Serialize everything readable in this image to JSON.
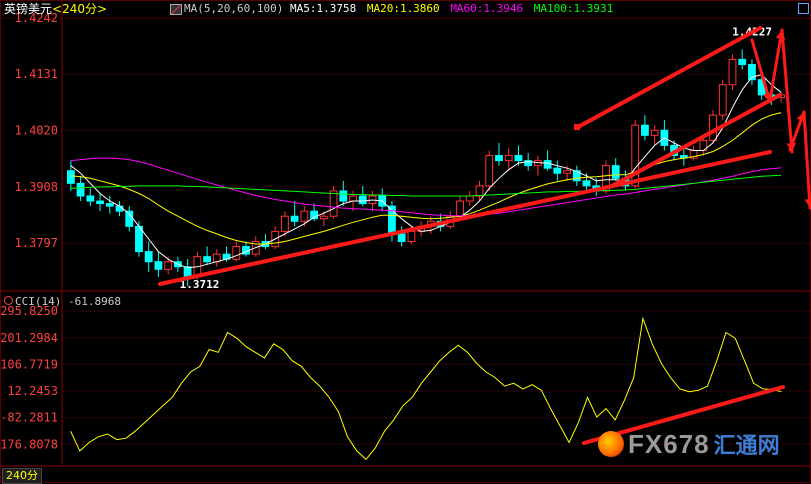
{
  "header": {
    "symbol": "英镑美元",
    "period": "<240分>",
    "ma_prefix": "MA(5,20,60,100)",
    "ma5": "MA5:1.3758",
    "ma20": "MA20:1.3860",
    "ma60": "MA60:1.3946",
    "ma100": "MA100:1.3931"
  },
  "cci_header": "CCI(14)  -61.8968",
  "bottom_period": "240分",
  "watermark": {
    "brand": "FX678",
    "cn": "汇通网"
  },
  "low_label": "1.3712",
  "high_label": "1.4227",
  "colors": {
    "up": "#ff3333",
    "down": "#00ffff",
    "ma5": "#ffffff",
    "ma20": "#ffff00",
    "ma60": "#ff00ff",
    "ma100": "#00ff00",
    "cci": "#ffff00",
    "annotation": "#ff1a1a",
    "grid": "#8b0000",
    "axis_text": "#ff4040"
  },
  "chart_data": [
    {
      "type": "candlestick",
      "title": "英镑美元 240分",
      "ylim": [
        1.3712,
        1.4242
      ],
      "yticks": [
        "1.4242",
        "1.4131",
        "1.4020",
        "1.3908",
        "1.3797"
      ],
      "ytick_values": [
        1.4242,
        1.4131,
        1.402,
        1.3908,
        1.3797
      ],
      "annotations": {
        "low": 1.3712,
        "high": 1.4227
      },
      "series_ohlc": [
        [
          1.394,
          1.396,
          1.39,
          1.3915
        ],
        [
          1.3915,
          1.393,
          1.388,
          1.389
        ],
        [
          1.389,
          1.3905,
          1.387,
          1.388
        ],
        [
          1.388,
          1.3895,
          1.386,
          1.3875
        ],
        [
          1.3875,
          1.389,
          1.3855,
          1.387
        ],
        [
          1.387,
          1.388,
          1.385,
          1.386
        ],
        [
          1.386,
          1.387,
          1.382,
          1.383
        ],
        [
          1.383,
          1.384,
          1.377,
          1.378
        ],
        [
          1.378,
          1.38,
          1.374,
          1.376
        ],
        [
          1.376,
          1.378,
          1.373,
          1.3745
        ],
        [
          1.3745,
          1.377,
          1.3735,
          1.376
        ],
        [
          1.376,
          1.377,
          1.374,
          1.375
        ],
        [
          1.375,
          1.3765,
          1.3712,
          1.373
        ],
        [
          1.373,
          1.378,
          1.3725,
          1.377
        ],
        [
          1.377,
          1.379,
          1.3755,
          1.376
        ],
        [
          1.376,
          1.3785,
          1.375,
          1.3775
        ],
        [
          1.3775,
          1.379,
          1.376,
          1.3765
        ],
        [
          1.3765,
          1.38,
          1.376,
          1.379
        ],
        [
          1.379,
          1.38,
          1.377,
          1.3775
        ],
        [
          1.3775,
          1.381,
          1.377,
          1.38
        ],
        [
          1.38,
          1.3815,
          1.3785,
          1.379
        ],
        [
          1.379,
          1.383,
          1.3785,
          1.382
        ],
        [
          1.382,
          1.386,
          1.381,
          1.385
        ],
        [
          1.385,
          1.388,
          1.383,
          1.384
        ],
        [
          1.384,
          1.387,
          1.383,
          1.386
        ],
        [
          1.386,
          1.3875,
          1.384,
          1.3845
        ],
        [
          1.3845,
          1.386,
          1.383,
          1.385
        ],
        [
          1.385,
          1.391,
          1.3845,
          1.39
        ],
        [
          1.39,
          1.392,
          1.387,
          1.388
        ],
        [
          1.388,
          1.39,
          1.386,
          1.389
        ],
        [
          1.389,
          1.391,
          1.387,
          1.3875
        ],
        [
          1.3875,
          1.39,
          1.386,
          1.389
        ],
        [
          1.389,
          1.3905,
          1.386,
          1.387
        ],
        [
          1.387,
          1.388,
          1.38,
          1.3815
        ],
        [
          1.3815,
          1.383,
          1.379,
          1.38
        ],
        [
          1.38,
          1.383,
          1.3795,
          1.382
        ],
        [
          1.382,
          1.384,
          1.381,
          1.383
        ],
        [
          1.383,
          1.385,
          1.3815,
          1.384
        ],
        [
          1.384,
          1.3855,
          1.382,
          1.383
        ],
        [
          1.383,
          1.386,
          1.3825,
          1.385
        ],
        [
          1.385,
          1.389,
          1.3845,
          1.388
        ],
        [
          1.388,
          1.39,
          1.387,
          1.389
        ],
        [
          1.389,
          1.392,
          1.388,
          1.391
        ],
        [
          1.391,
          1.398,
          1.39,
          1.397
        ],
        [
          1.397,
          1.3995,
          1.395,
          1.396
        ],
        [
          1.396,
          1.3985,
          1.394,
          1.397
        ],
        [
          1.397,
          1.399,
          1.395,
          1.396
        ],
        [
          1.396,
          1.3975,
          1.394,
          1.395
        ],
        [
          1.395,
          1.397,
          1.393,
          1.396
        ],
        [
          1.396,
          1.398,
          1.394,
          1.3945
        ],
        [
          1.3945,
          1.396,
          1.392,
          1.3935
        ],
        [
          1.3935,
          1.395,
          1.392,
          1.394
        ],
        [
          1.394,
          1.395,
          1.391,
          1.392
        ],
        [
          1.392,
          1.3935,
          1.39,
          1.391
        ],
        [
          1.391,
          1.3925,
          1.389,
          1.39
        ],
        [
          1.39,
          1.396,
          1.3895,
          1.395
        ],
        [
          1.395,
          1.3965,
          1.392,
          1.3925
        ],
        [
          1.3925,
          1.394,
          1.39,
          1.391
        ],
        [
          1.391,
          1.404,
          1.3905,
          1.403
        ],
        [
          1.403,
          1.405,
          1.4,
          1.401
        ],
        [
          1.401,
          1.403,
          1.399,
          1.402
        ],
        [
          1.402,
          1.404,
          1.398,
          1.399
        ],
        [
          1.399,
          1.4,
          1.396,
          1.397
        ],
        [
          1.397,
          1.3985,
          1.395,
          1.3965
        ],
        [
          1.3965,
          1.399,
          1.396,
          1.398
        ],
        [
          1.398,
          1.401,
          1.397,
          1.4
        ],
        [
          1.4,
          1.406,
          1.3995,
          1.405
        ],
        [
          1.405,
          1.412,
          1.404,
          1.411
        ],
        [
          1.411,
          1.417,
          1.41,
          1.416
        ],
        [
          1.416,
          1.418,
          1.414,
          1.415
        ],
        [
          1.415,
          1.416,
          1.411,
          1.412
        ],
        [
          1.412,
          1.413,
          1.408,
          1.409
        ],
        [
          1.409,
          1.41,
          1.407,
          1.4085
        ],
        [
          1.4085,
          1.4095,
          1.4075,
          1.409
        ]
      ],
      "ma_series": [
        {
          "name": "MA5",
          "values": [
            1.395,
            1.3935,
            1.3915,
            1.3895,
            1.388,
            1.387,
            1.3855,
            1.383,
            1.3805,
            1.378,
            1.3765,
            1.3755,
            1.3748,
            1.375,
            1.3755,
            1.376,
            1.3765,
            1.3772,
            1.378,
            1.3788,
            1.3795,
            1.3805,
            1.3815,
            1.3825,
            1.3835,
            1.3848,
            1.3856,
            1.3865,
            1.3875,
            1.388,
            1.388,
            1.3882,
            1.388,
            1.3862,
            1.3845,
            1.383,
            1.382,
            1.3822,
            1.383,
            1.3838,
            1.3848,
            1.3862,
            1.388,
            1.3905,
            1.3925,
            1.3942,
            1.3955,
            1.3958,
            1.3956,
            1.3955,
            1.395,
            1.3945,
            1.3938,
            1.393,
            1.392,
            1.3922,
            1.3922,
            1.392,
            1.3945,
            1.3968,
            1.399,
            1.4005,
            1.3995,
            1.3985,
            1.398,
            1.398,
            1.3995,
            1.4025,
            1.4065,
            1.41,
            1.4125,
            1.413,
            1.411,
            1.4095
          ]
        },
        {
          "name": "MA20",
          "values": [
            1.393,
            1.3928,
            1.3925,
            1.392,
            1.3915,
            1.391,
            1.3903,
            1.3895,
            1.3885,
            1.3872,
            1.386,
            1.385,
            1.384,
            1.383,
            1.3822,
            1.3815,
            1.3808,
            1.3802,
            1.3798,
            1.3795,
            1.3795,
            1.3797,
            1.38,
            1.3805,
            1.381,
            1.3815,
            1.382,
            1.3826,
            1.3832,
            1.3838,
            1.3843,
            1.3848,
            1.3852,
            1.3852,
            1.385,
            1.3848,
            1.3846,
            1.3845,
            1.3846,
            1.3848,
            1.385,
            1.3855,
            1.3862,
            1.387,
            1.3878,
            1.3887,
            1.3895,
            1.3902,
            1.3908,
            1.3914,
            1.3918,
            1.3922,
            1.3925,
            1.3927,
            1.3928,
            1.393,
            1.3932,
            1.3932,
            1.3938,
            1.3945,
            1.3952,
            1.3958,
            1.3962,
            1.3965,
            1.3968,
            1.3972,
            1.3978,
            1.3988,
            1.4,
            1.4015,
            1.403,
            1.4042,
            1.405,
            1.4055
          ]
        },
        {
          "name": "MA60",
          "values": [
            1.396,
            1.3962,
            1.3964,
            1.3965,
            1.3965,
            1.3964,
            1.3962,
            1.3958,
            1.3953,
            1.3947,
            1.3941,
            1.3935,
            1.3929,
            1.3923,
            1.3917,
            1.3912,
            1.3906,
            1.3901,
            1.3896,
            1.3891,
            1.3887,
            1.3883,
            1.388,
            1.3877,
            1.3874,
            1.3872,
            1.387,
            1.3868,
            1.3866,
            1.3865,
            1.3864,
            1.3863,
            1.3862,
            1.3861,
            1.3859,
            1.3857,
            1.3855,
            1.3853,
            1.3852,
            1.3851,
            1.3851,
            1.3851,
            1.3852,
            1.3854,
            1.3856,
            1.3859,
            1.3862,
            1.3865,
            1.3868,
            1.3871,
            1.3874,
            1.3877,
            1.388,
            1.3883,
            1.3886,
            1.3889,
            1.3892,
            1.3894,
            1.3897,
            1.39,
            1.3903,
            1.3906,
            1.3909,
            1.3912,
            1.3915,
            1.3918,
            1.3921,
            1.3925,
            1.3929,
            1.3934,
            1.3938,
            1.3942,
            1.3944,
            1.3946
          ]
        },
        {
          "name": "MA100",
          "values": [
            1.3905,
            1.3906,
            1.3907,
            1.3908,
            1.3908,
            1.3909,
            1.3909,
            1.391,
            1.391,
            1.391,
            1.391,
            1.391,
            1.3909,
            1.3909,
            1.3908,
            1.3907,
            1.3906,
            1.3905,
            1.3904,
            1.3903,
            1.3902,
            1.3901,
            1.39,
            1.3899,
            1.3898,
            1.3897,
            1.3896,
            1.3895,
            1.3894,
            1.3893,
            1.3893,
            1.3892,
            1.3892,
            1.3891,
            1.3891,
            1.389,
            1.389,
            1.389,
            1.389,
            1.389,
            1.389,
            1.389,
            1.3891,
            1.3892,
            1.3893,
            1.3894,
            1.3895,
            1.3896,
            1.3897,
            1.3898,
            1.3898,
            1.3899,
            1.3899,
            1.39,
            1.39,
            1.3901,
            1.3901,
            1.3902,
            1.3903,
            1.3905,
            1.3907,
            1.3909,
            1.3911,
            1.3913,
            1.3915,
            1.3917,
            1.3919,
            1.3921,
            1.3923,
            1.3925,
            1.3927,
            1.3929,
            1.393,
            1.3931
          ]
        }
      ]
    },
    {
      "type": "line",
      "title": "CCI(14)",
      "ylim": [
        -250,
        300
      ],
      "yticks": [
        "295.8250",
        "201.2984",
        "106.7719",
        "12.2453",
        "-82.2811",
        "-176.8078"
      ],
      "ytick_values": [
        295.825,
        201.2984,
        106.7719,
        12.2453,
        -82.2811,
        -176.8078
      ],
      "series": [
        {
          "name": "CCI(14)",
          "values": [
            -130,
            -200,
            -170,
            -150,
            -140,
            -160,
            -155,
            -130,
            -100,
            -70,
            -40,
            -10,
            40,
            80,
            100,
            160,
            150,
            220,
            200,
            170,
            150,
            130,
            180,
            160,
            120,
            100,
            60,
            30,
            -10,
            -60,
            -150,
            -200,
            -230,
            -190,
            -130,
            -90,
            -40,
            -10,
            40,
            80,
            120,
            150,
            175,
            150,
            110,
            80,
            60,
            30,
            40,
            20,
            35,
            15,
            -50,
            -110,
            -170,
            -100,
            -10,
            -80,
            -50,
            -90,
            -20,
            60,
            270,
            180,
            110,
            60,
            20,
            10,
            15,
            30,
            120,
            220,
            200,
            120,
            40,
            20,
            18,
            10
          ]
        }
      ]
    }
  ]
}
